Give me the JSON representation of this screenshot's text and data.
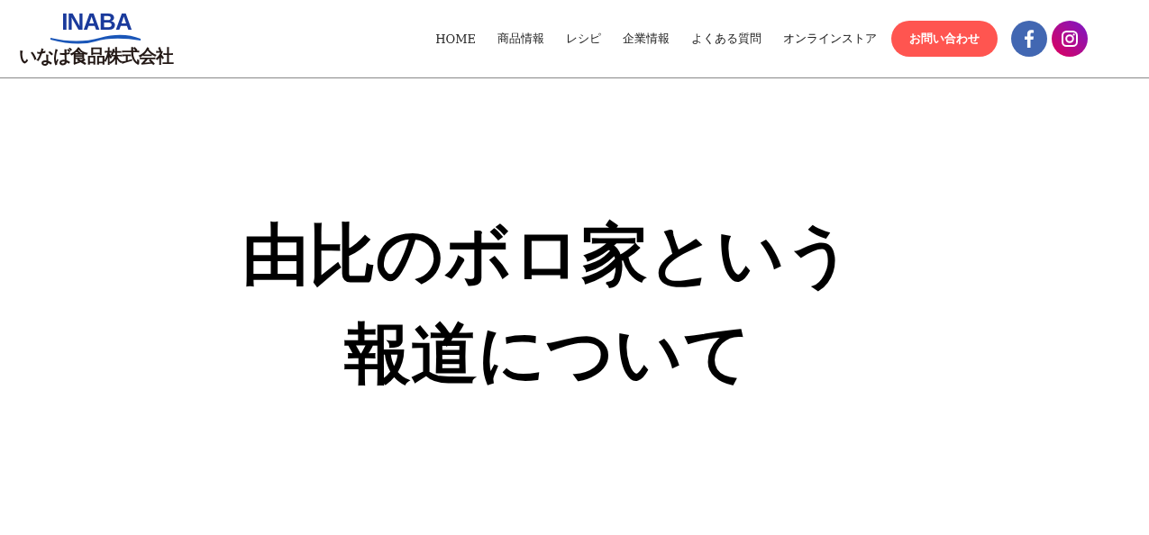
{
  "logo": {
    "brand": "INABA",
    "company": "いなば食品株式会社"
  },
  "nav": [
    {
      "label": "HOME"
    },
    {
      "label": "商品情報"
    },
    {
      "label": "レシピ"
    },
    {
      "label": "企業情報"
    },
    {
      "label": "よくある質問"
    },
    {
      "label": "オンラインストア"
    }
  ],
  "contact_button": "お問い合わせ",
  "social": [
    {
      "kind": "facebook"
    },
    {
      "kind": "instagram"
    }
  ],
  "heading": [
    "由比のボロ家という",
    "報道について"
  ]
}
